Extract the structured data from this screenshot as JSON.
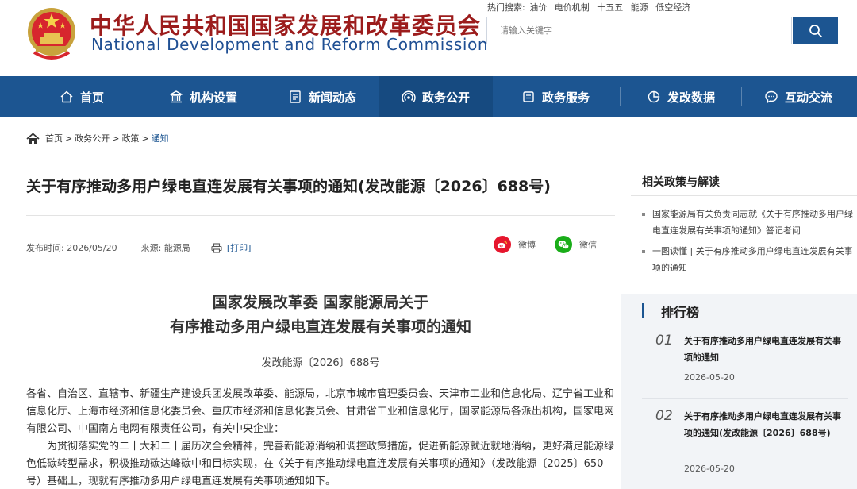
{
  "header": {
    "title_cn": "中华人民共和国国家发展和改革委员会",
    "title_en": "National Development and Reform Commission",
    "hot_search": {
      "label": "热门搜索:",
      "terms": [
        "油价",
        "电价机制",
        "十五五",
        "能源",
        "低空经济"
      ]
    },
    "search": {
      "placeholder": "请输入关键字"
    }
  },
  "nav": {
    "items": [
      {
        "label": "首页",
        "icon": "home-icon"
      },
      {
        "label": "机构设置",
        "icon": "building-icon"
      },
      {
        "label": "新闻动态",
        "icon": "news-icon"
      },
      {
        "label": "政务公开",
        "icon": "broadcast-icon"
      },
      {
        "label": "政务服务",
        "icon": "document-icon"
      },
      {
        "label": "发改数据",
        "icon": "pie-chart-icon"
      },
      {
        "label": "互动交流",
        "icon": "chat-icon"
      }
    ],
    "active_index": 3,
    "color": "#1c5591"
  },
  "breadcrumb": {
    "items": [
      "首页",
      "政务公开",
      "政策",
      "通知"
    ],
    "separator": ">"
  },
  "article": {
    "title": "关于有序推动多用户绿电直连发展有关事项的通知(发改能源〔2026〕688号)",
    "publish_label": "发布时间: 2026/05/20",
    "source_label": "来源: 能源局",
    "print_label": "[打印]",
    "share": {
      "weibo": "微博",
      "wechat": "微信"
    },
    "heading_line1": "国家发展改革委 国家能源局关于",
    "heading_line2": "有序推动多用户绿电直连发展有关事项的通知",
    "doc_number": "发改能源〔2026〕688号",
    "paragraph1": "各省、自治区、直辖市、新疆生产建设兵团发展改革委、能源局，北京市城市管理委员会、天津市工业和信息化局、辽宁省工业和信息化厅、上海市经济和信息化委员会、重庆市经济和信息化委员会、甘肃省工业和信息化厅，国家能源局各派出机构，国家电网有限公司、中国南方电网有限责任公司，有关中央企业：",
    "paragraph2": "为贯彻落实党的二十大和二十届历次全会精神，完善新能源消纳和调控政策措施，促进新能源就近就地消纳，更好满足能源绿色低碳转型需求，积极推动碳达峰碳中和目标实现，在《关于有序推动绿电直连发展有关事项的通知》（发改能源〔2025〕650号）基础上，现就有序推动多用户绿电直连发展有关事项通知如下。"
  },
  "sidebar": {
    "related_title": "相关政策与解读",
    "related_links": [
      "国家能源局有关负责同志就《关于有序推动多用户绿电直连发展有关事项的通知》答记者问",
      "一图读懂 | 关于有序推动多用户绿电直连发展有关事项的通知"
    ],
    "ranking_title": "排行榜",
    "ranking": [
      {
        "num": "01",
        "title": "关于有序推动多用户绿电直连发展有关事项的通知",
        "date": "2026-05-20"
      },
      {
        "num": "02",
        "title": "关于有序推动多用户绿电直连发展有关事项的通知(发改能源〔2026〕688号)",
        "date": "2026-05-20"
      }
    ]
  }
}
